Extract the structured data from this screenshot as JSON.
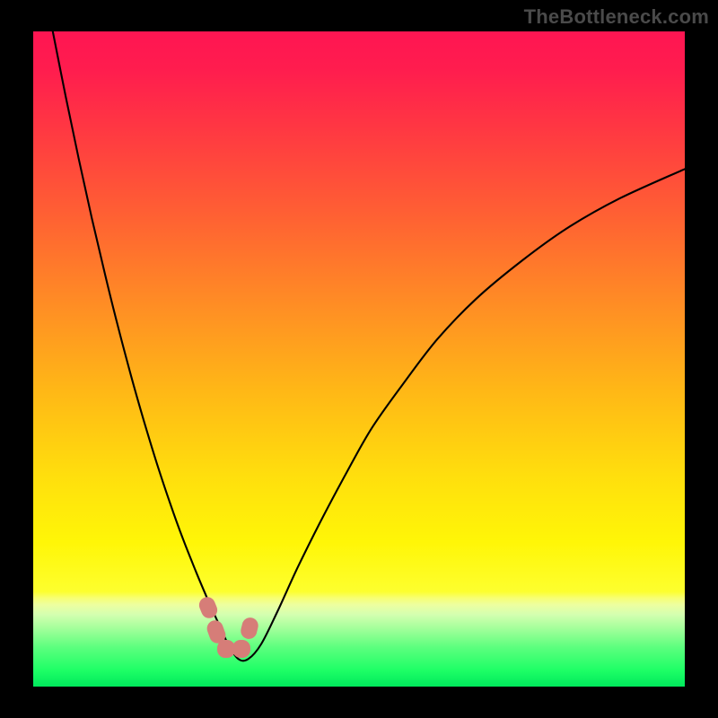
{
  "watermark": "TheBottleneck.com",
  "plot": {
    "gradient_stops": [
      {
        "offset": 0.0,
        "color": "#ff1552"
      },
      {
        "offset": 0.06,
        "color": "#ff1d4e"
      },
      {
        "offset": 0.15,
        "color": "#ff3842"
      },
      {
        "offset": 0.28,
        "color": "#ff6033"
      },
      {
        "offset": 0.42,
        "color": "#ff8e24"
      },
      {
        "offset": 0.55,
        "color": "#ffb816"
      },
      {
        "offset": 0.68,
        "color": "#ffdf0d"
      },
      {
        "offset": 0.78,
        "color": "#fff607"
      },
      {
        "offset": 0.855,
        "color": "#fdff2e"
      },
      {
        "offset": 0.865,
        "color": "#f7ff74"
      },
      {
        "offset": 0.875,
        "color": "#edffa0"
      },
      {
        "offset": 0.89,
        "color": "#d4ffb0"
      },
      {
        "offset": 0.91,
        "color": "#a6ff9c"
      },
      {
        "offset": 0.94,
        "color": "#5cff7e"
      },
      {
        "offset": 0.975,
        "color": "#1eff66"
      },
      {
        "offset": 1.0,
        "color": "#00e85c"
      }
    ],
    "blob_color": "#d67d78"
  },
  "chart_data": {
    "type": "line",
    "title": "",
    "xlabel": "",
    "ylabel": "",
    "xlim": [
      0,
      100
    ],
    "ylim": [
      0,
      100
    ],
    "series": [
      {
        "name": "bottleneck-curve",
        "x": [
          3,
          5,
          7,
          9,
          11,
          13,
          15,
          17,
          19,
          21,
          23,
          25,
          27,
          28.5,
          30,
          31.5,
          33,
          35,
          37.5,
          40.5,
          44,
          48,
          52,
          57,
          62,
          68,
          75,
          82,
          90,
          100
        ],
        "y": [
          100,
          90,
          80.5,
          71.5,
          63,
          55,
          47.5,
          40.5,
          34,
          28,
          22.5,
          17.5,
          12.8,
          9.5,
          6.3,
          4.2,
          4.2,
          6.5,
          11.5,
          18,
          25,
          32.5,
          39.5,
          46.5,
          53,
          59.2,
          65,
          70,
          74.5,
          79
        ]
      }
    ],
    "markers": [
      {
        "name": "left-upper-blob",
        "x": 27.0,
        "y": 12.0
      },
      {
        "name": "left-lower-blob",
        "x": 28.4,
        "y": 8.2
      },
      {
        "name": "bottom-left-blob",
        "x": 29.6,
        "y": 5.1
      },
      {
        "name": "bottom-right-blob",
        "x": 31.8,
        "y": 5.1
      },
      {
        "name": "right-blob",
        "x": 33.3,
        "y": 8.8
      }
    ]
  }
}
